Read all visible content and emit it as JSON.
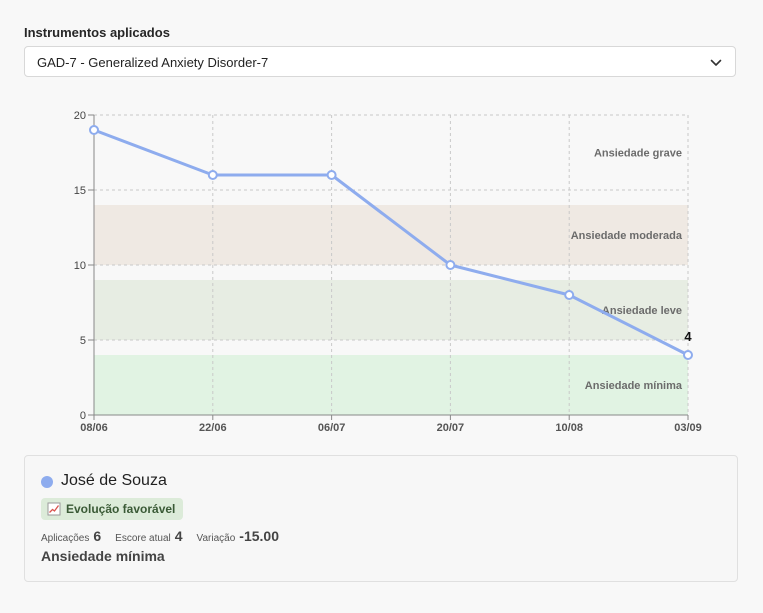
{
  "instruments": {
    "label": "Instrumentos aplicados",
    "selected": "GAD-7 - Generalized Anxiety Disorder-7",
    "chevron_icon": "chevron-down-icon"
  },
  "chart_data": {
    "type": "line",
    "categories": [
      "08/06",
      "22/06",
      "06/07",
      "20/07",
      "10/08",
      "03/09"
    ],
    "series": [
      {
        "values": [
          19,
          16,
          16,
          10,
          8,
          4
        ],
        "color": "#8eacee"
      }
    ],
    "ylim": [
      0,
      20
    ],
    "yticks": [
      0,
      5,
      10,
      15,
      20
    ],
    "grid": true,
    "last_point_label": "4",
    "bands": [
      {
        "label": "Ansiedade grave",
        "from": 15,
        "to": 20,
        "color": "#f8f8f8"
      },
      {
        "label": "Ansiedade moderada",
        "from": 10,
        "to": 14,
        "color": "#efe9e3"
      },
      {
        "label": "Ansiedade leve",
        "from": 5,
        "to": 9,
        "color": "#e7ede3"
      },
      {
        "label": "Ansiedade mínima",
        "from": 0,
        "to": 4,
        "color": "#e1f3e3"
      }
    ],
    "title": "",
    "xlabel": "",
    "ylabel": ""
  },
  "patient": {
    "name": "José de Souza",
    "color": "#8eacee",
    "trend": {
      "label": "Evolução favorável",
      "icon": "trend-chart-icon"
    },
    "stats": [
      {
        "label": "Aplicações",
        "value": "6"
      },
      {
        "label": "Escore atual",
        "value": "4"
      },
      {
        "label": "Variação",
        "value": "-15.00"
      }
    ],
    "severity": "Ansiedade mínima"
  }
}
